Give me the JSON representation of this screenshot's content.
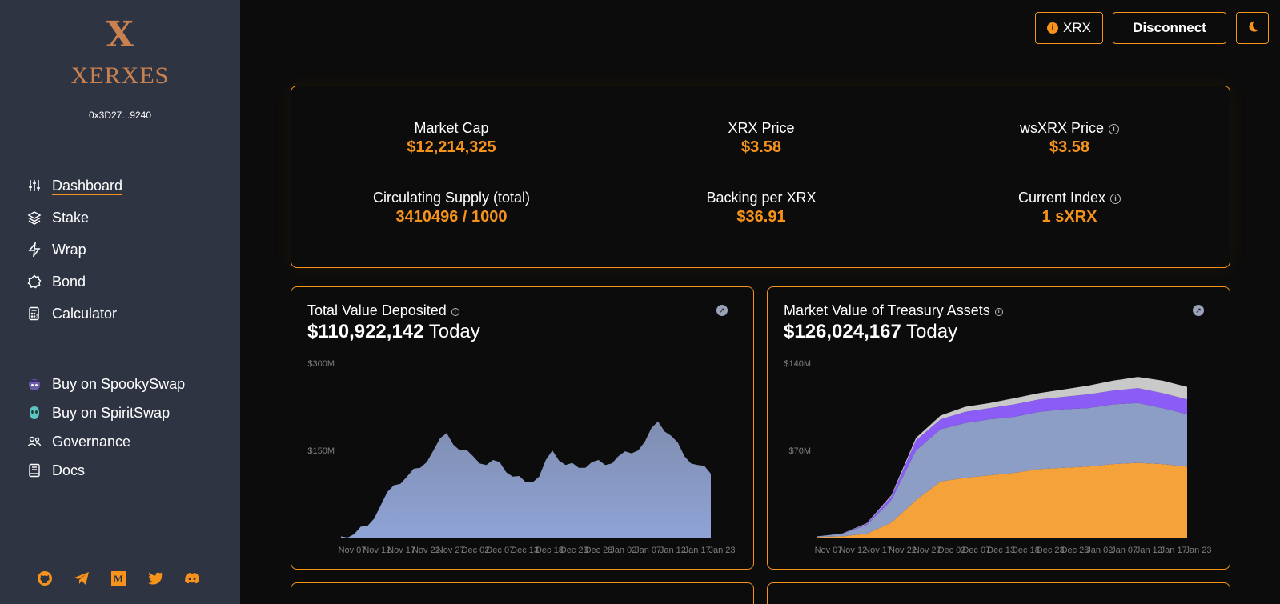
{
  "brand": {
    "mark": "X",
    "name": "XERXES"
  },
  "wallet": {
    "address": "0x3D27...9240"
  },
  "nav": [
    {
      "label": "Dashboard",
      "icon": "sliders-icon",
      "active": true
    },
    {
      "label": "Stake",
      "icon": "layers-icon"
    },
    {
      "label": "Wrap",
      "icon": "zap-icon"
    },
    {
      "label": "Bond",
      "icon": "bond-icon"
    },
    {
      "label": "Calculator",
      "icon": "calculator-icon"
    }
  ],
  "external": [
    {
      "label": "Buy on SpookySwap",
      "icon": "spookyswap-icon"
    },
    {
      "label": "Buy on SpiritSwap",
      "icon": "spiritswap-icon"
    },
    {
      "label": "Governance",
      "icon": "users-icon"
    },
    {
      "label": "Docs",
      "icon": "book-icon"
    }
  ],
  "socials": [
    "github-icon",
    "telegram-icon",
    "medium-icon",
    "twitter-icon",
    "discord-icon"
  ],
  "header": {
    "token_label": "XRX",
    "disconnect_label": "Disconnect",
    "theme_icon": "moon-icon"
  },
  "stats": {
    "market_cap": {
      "label": "Market Cap",
      "value": "$12,214,325"
    },
    "xrx_price": {
      "label": "XRX Price",
      "value": "$3.58"
    },
    "wsxrx_price": {
      "label": "wsXRX Price",
      "value": "$3.58"
    },
    "circ_supply": {
      "label": "Circulating Supply (total)",
      "value": "3410496 / 1000"
    },
    "backing": {
      "label": "Backing per XRX",
      "value": "$36.91"
    },
    "index": {
      "label": "Current Index",
      "value": "1 sXRX"
    }
  },
  "colors": {
    "accent": "#f7931a",
    "sidebar": "#2f3443",
    "tvd_fill": "#8fa3d6",
    "dai": "#f6a23b",
    "frax": "#8d9ec6",
    "wftm": "#8b5cf6",
    "other": "#c9c9c9"
  },
  "cards": {
    "tvd": {
      "title": "Total Value Deposited",
      "value": "$110,922,142",
      "suffix": "Today"
    },
    "mvt": {
      "title": "Market Value of Treasury Assets",
      "value": "$126,024,167",
      "suffix": "Today"
    }
  },
  "chart_data": [
    {
      "type": "area",
      "title": "Total Value Deposited",
      "y_ticks": [
        "$300M",
        "$150M"
      ],
      "x_ticks": [
        "Nov 07",
        "Nov 12",
        "Nov 17",
        "Nov 22",
        "Nov 27",
        "Dec 02",
        "Dec 07",
        "Dec 13",
        "Dec 18",
        "Dec 23",
        "Dec 28",
        "Jan 02",
        "Jan 07",
        "Jan 12",
        "Jan 17",
        "Jan 23"
      ],
      "ylim": [
        0,
        300
      ],
      "x": [
        "Nov 07",
        "Nov 12",
        "Nov 17",
        "Nov 20",
        "Nov 22",
        "Nov 25",
        "Nov 27",
        "Nov 30",
        "Dec 02",
        "Dec 05",
        "Dec 07",
        "Dec 10",
        "Dec 13",
        "Dec 15",
        "Dec 18",
        "Dec 21",
        "Dec 23",
        "Dec 26",
        "Dec 28",
        "Dec 31",
        "Jan 02",
        "Jan 05",
        "Jan 07",
        "Jan 10",
        "Jan 12",
        "Jan 15",
        "Jan 17",
        "Jan 20",
        "Jan 23"
      ],
      "values": [
        2,
        6,
        20,
        55,
        90,
        105,
        120,
        150,
        180,
        150,
        140,
        125,
        130,
        105,
        95,
        105,
        150,
        125,
        120,
        130,
        125,
        140,
        145,
        165,
        200,
        175,
        140,
        125,
        110
      ],
      "series": [
        {
          "name": "Total Value Deposited"
        }
      ]
    },
    {
      "type": "area",
      "title": "Market Value of Treasury Assets",
      "y_ticks": [
        "$140M",
        "$70M"
      ],
      "x_ticks": [
        "Nov 07",
        "Nov 12",
        "Nov 17",
        "Nov 22",
        "Nov 27",
        "Dec 02",
        "Dec 07",
        "Dec 13",
        "Dec 18",
        "Dec 23",
        "Dec 28",
        "Jan 02",
        "Jan 07",
        "Jan 12",
        "Jan 17",
        "Jan 23"
      ],
      "ylim": [
        0,
        140
      ],
      "x": [
        "Nov 07",
        "Nov 12",
        "Nov 17",
        "Nov 22",
        "Nov 27",
        "Dec 02",
        "Dec 07",
        "Dec 13",
        "Dec 18",
        "Dec 23",
        "Dec 28",
        "Jan 02",
        "Jan 07",
        "Jan 12",
        "Jan 17",
        "Jan 23"
      ],
      "stacked": true,
      "series": [
        {
          "color": "#f6a23b",
          "values": [
            0.5,
            1,
            3,
            12,
            30,
            45,
            48,
            50,
            52,
            55,
            56,
            57,
            59,
            60,
            59,
            57
          ]
        },
        {
          "color": "#8d9ec6",
          "values": [
            0.5,
            2,
            7,
            18,
            40,
            42,
            44,
            45,
            45,
            46,
            47,
            47,
            48,
            48,
            45,
            42
          ]
        },
        {
          "color": "#8b5cf6",
          "values": [
            0,
            0.2,
            1,
            3,
            8,
            8,
            9,
            9,
            10,
            10,
            10,
            11,
            11,
            12,
            12,
            12
          ]
        },
        {
          "color": "#c9c9c9",
          "values": [
            0,
            0.1,
            0.5,
            1,
            2,
            3,
            4,
            4,
            5,
            5,
            6,
            7,
            8,
            9,
            10,
            10
          ]
        }
      ]
    }
  ]
}
